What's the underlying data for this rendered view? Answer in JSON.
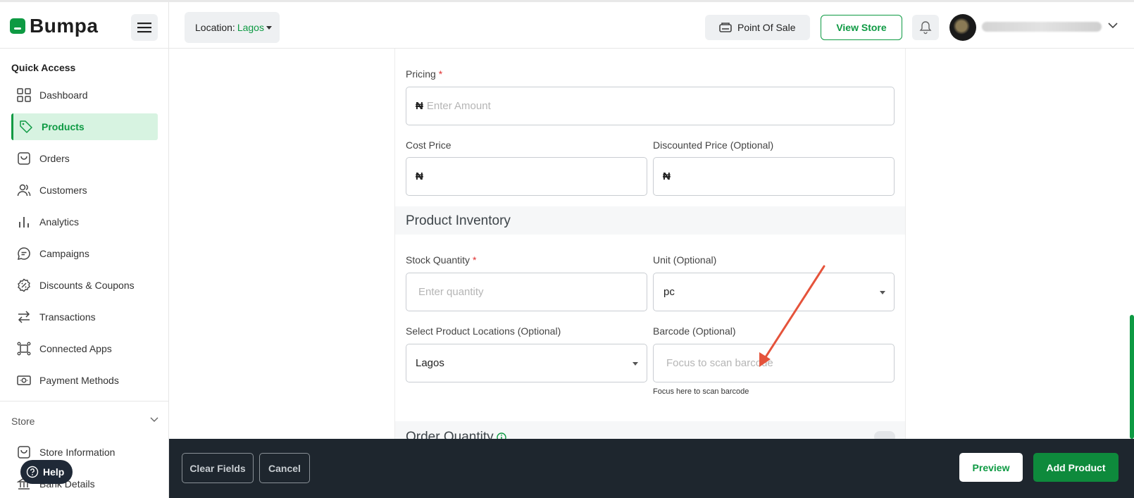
{
  "header": {
    "logo_text": "Bumpa",
    "location_label": "Location:",
    "location_value": "Lagos",
    "pos_label": "Point Of Sale",
    "view_store_label": "View Store"
  },
  "sidebar": {
    "quick_access_title": "Quick Access",
    "items": [
      {
        "label": "Dashboard",
        "icon": "grid-icon"
      },
      {
        "label": "Products",
        "icon": "tag-icon",
        "active": true
      },
      {
        "label": "Orders",
        "icon": "bag-icon"
      },
      {
        "label": "Customers",
        "icon": "users-icon"
      },
      {
        "label": "Analytics",
        "icon": "bar-chart-icon"
      },
      {
        "label": "Campaigns",
        "icon": "chat-icon"
      },
      {
        "label": "Discounts & Coupons",
        "icon": "discount-badge-icon"
      },
      {
        "label": "Transactions",
        "icon": "swap-icon"
      },
      {
        "label": "Connected Apps",
        "icon": "apps-icon"
      },
      {
        "label": "Payment Methods",
        "icon": "money-icon"
      }
    ],
    "store_title": "Store",
    "store_items": [
      {
        "label": "Store Information",
        "icon": "bag-icon"
      },
      {
        "label": "Bank Details",
        "icon": "bank-icon"
      }
    ],
    "help_label": "Help"
  },
  "form": {
    "pricing_label": "Pricing",
    "currency_symbol": "₦",
    "pricing_placeholder": "Enter Amount",
    "cost_price_label": "Cost Price",
    "discounted_price_label": "Discounted Price (Optional)",
    "inventory_title": "Product Inventory",
    "stock_quantity_label": "Stock Quantity",
    "stock_quantity_placeholder": "Enter quantity",
    "unit_label": "Unit (Optional)",
    "unit_value": "pc",
    "locations_label": "Select Product Locations (Optional)",
    "locations_value": "Lagos",
    "barcode_label": "Barcode (Optional)",
    "barcode_placeholder": "Focus to scan barcode",
    "barcode_helper": "Focus here to scan barcode",
    "order_quantity_title": "Order Quantity",
    "required_mark": "*"
  },
  "footer": {
    "clear_fields_label": "Clear Fields",
    "cancel_label": "Cancel",
    "preview_label": "Preview",
    "add_product_label": "Add Product"
  },
  "colors": {
    "brand_green": "#0e9a43",
    "active_bg": "#d7f3e1",
    "footer_bg": "#1e262e",
    "annotation_arrow": "#e5533b"
  }
}
